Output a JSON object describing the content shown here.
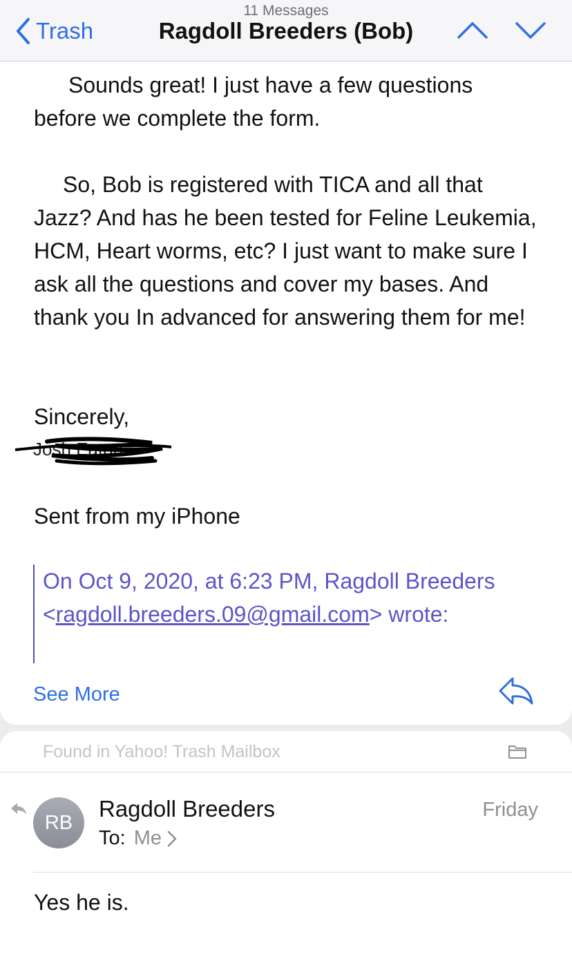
{
  "nav": {
    "message_count": "11 Messages",
    "back_label": "Trash",
    "title": "Ragdoll Breeders (Bob)"
  },
  "message1": {
    "para1": "Sounds great! I just have a few questions before we complete the form.",
    "para2": "So, Bob is registered with TICA and all that Jazz? And has he been tested for Feline Leukemia, HCM, Heart worms, etc? I just want to make sure I ask all the questions and cover my bases. And thank you In advanced for answering them for me!",
    "closing": "Sincerely,",
    "signature": "Sent from my iPhone",
    "quote_intro": "On Oct 9, 2020, at 6:23 PM, Ragdoll Breeders",
    "quote_lt": "<",
    "quote_email": "ragdoll.breeders.09@gmail.com",
    "quote_suffix": "> wrote:",
    "see_more": "See More"
  },
  "message2": {
    "found_in": "Found in Yahoo! Trash Mailbox",
    "avatar_initials": "RB",
    "sender": "Ragdoll Breeders",
    "to_label": "To:",
    "to_value": "Me",
    "date": "Friday",
    "body": "Yes he is."
  },
  "colors": {
    "accent": "#2f6fe0",
    "quote": "#5a55c8"
  },
  "icons": [
    "chevron-left-icon",
    "chevron-up-icon",
    "chevron-down-icon",
    "reply-icon",
    "folder-icon",
    "replied-icon",
    "chevron-right-icon"
  ]
}
